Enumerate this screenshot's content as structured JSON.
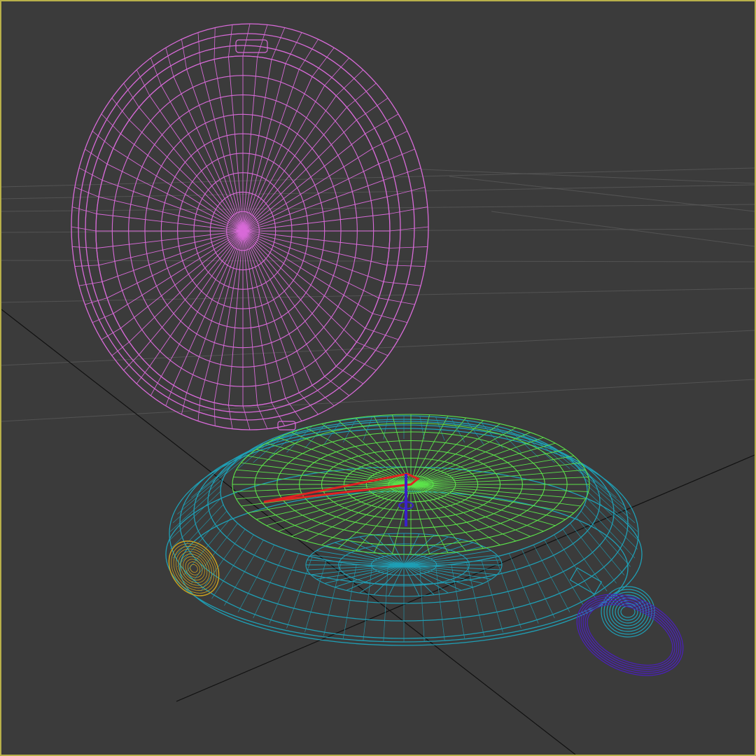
{
  "viewport": {
    "active_border_color": "#b8b04a",
    "background_color": "#3b3b3b",
    "grid_color": "#5a5a5a",
    "axis_color": "#111111"
  },
  "objects": [
    {
      "name": "watch-lid",
      "wireframe_color": "#d86ad8"
    },
    {
      "name": "watch-dial",
      "wireframe_color": "#5ce34a"
    },
    {
      "name": "watch-case",
      "wireframe_color": "#1f9fb5"
    },
    {
      "name": "hour-hand",
      "wireframe_color": "#e02222"
    },
    {
      "name": "center-pin",
      "wireframe_color": "#3a20c8"
    },
    {
      "name": "crown",
      "wireframe_color": "#1f9fb5"
    },
    {
      "name": "bow-ring",
      "wireframe_color": "#4a20b8"
    },
    {
      "name": "side-button",
      "wireframe_color": "#c8a020"
    }
  ]
}
